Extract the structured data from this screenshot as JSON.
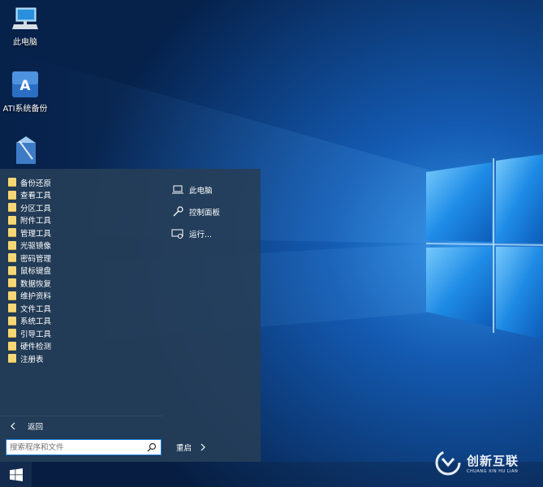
{
  "desktop": {
    "icons": [
      {
        "label": "此电脑"
      },
      {
        "label": "ATI系统备份"
      },
      {
        "label": ""
      }
    ]
  },
  "start_menu": {
    "folders": [
      {
        "label": "备份还原"
      },
      {
        "label": "查看工具"
      },
      {
        "label": "分区工具"
      },
      {
        "label": "附件工具"
      },
      {
        "label": "管理工具"
      },
      {
        "label": "光驱镜像"
      },
      {
        "label": "密码管理"
      },
      {
        "label": "鼠标键盘"
      },
      {
        "label": "数据恢复"
      },
      {
        "label": "维护资料"
      },
      {
        "label": "文件工具"
      },
      {
        "label": "系统工具"
      },
      {
        "label": "引导工具"
      },
      {
        "label": "硬件检测"
      },
      {
        "label": "注册表"
      }
    ],
    "right_items": [
      {
        "label": "此电脑",
        "icon": "laptop-icon"
      },
      {
        "label": "控制面板",
        "icon": "wrench-icon"
      },
      {
        "label": "运行...",
        "icon": "run-icon"
      }
    ],
    "back_label": "返回",
    "search": {
      "placeholder": "搜索程序和文件",
      "value": ""
    },
    "restart_label": "重启"
  },
  "watermark": {
    "name": "创新互联",
    "sub": "CHUANG XIN HU LIAN"
  },
  "colors": {
    "menu_bg": "#263e58",
    "accent": "#1479d4",
    "folder": "#f6d776"
  }
}
